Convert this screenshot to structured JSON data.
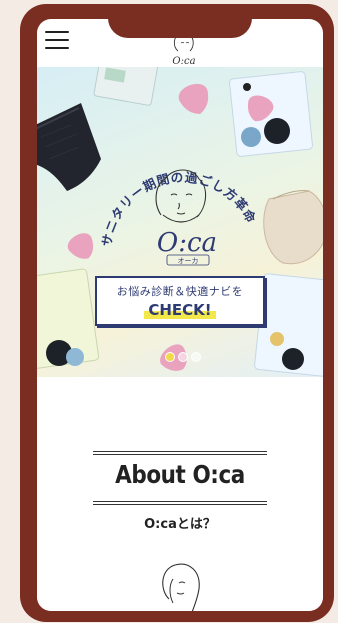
{
  "header": {
    "menu_icon": "hamburger-menu-icon",
    "logo_text": "O:ca"
  },
  "hero": {
    "arc_text": "サニタリー期間の過ごし方革命",
    "logo_text": "O:ca",
    "logo_sub": "オーカ",
    "cta": {
      "line1": "お悩み診断＆快適ナビを",
      "line2": "CHECK!"
    },
    "carousel": {
      "total": 3,
      "active_index": 0
    }
  },
  "about": {
    "title": "About O:ca",
    "subtitle": "O:caとは？"
  },
  "colors": {
    "frame": "#7a2e22",
    "navy": "#2e3b73",
    "highlight": "#f2e84a",
    "active_dot": "#f2d94a"
  }
}
